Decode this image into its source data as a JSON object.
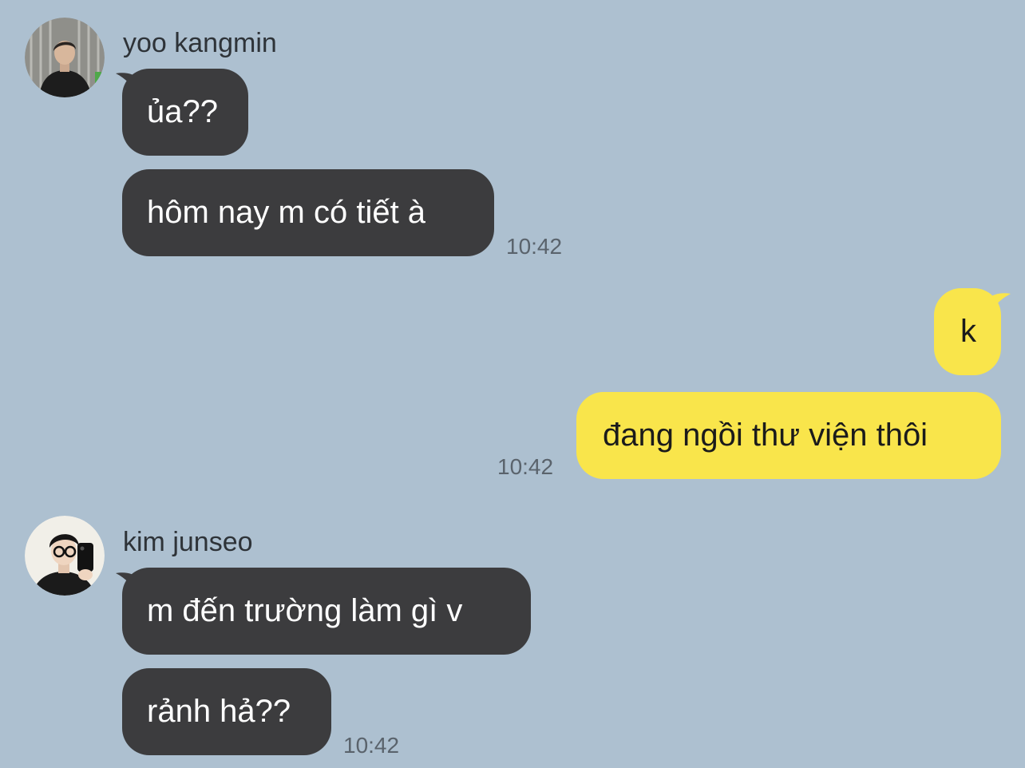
{
  "chat": {
    "background_color": "#adc0d0",
    "incoming_bubble_color": "#3c3c3e",
    "outgoing_bubble_color": "#f9e54b",
    "groups": [
      {
        "sender": "yoo kangmin",
        "avatar_icon": "profile-photo-icon",
        "messages": [
          "ủa??",
          "hôm nay m có tiết à"
        ],
        "time": "10:42"
      },
      {
        "sender": "",
        "outgoing": true,
        "messages": [
          "k",
          "đang ngồi thư viện thôi"
        ],
        "time": "10:42"
      },
      {
        "sender": "kim junseo",
        "avatar_icon": "profile-photo-icon",
        "messages": [
          "m đến trường làm gì v",
          "rảnh hả??"
        ],
        "time": "10:42"
      }
    ]
  }
}
